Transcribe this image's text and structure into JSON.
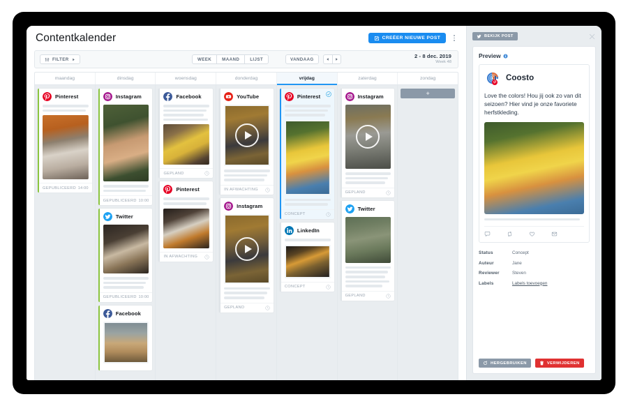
{
  "app": {
    "title": "Contentkalender",
    "create_post_label": "CREËER NIEUWE POST",
    "kebab_name": "more-options"
  },
  "toolbar": {
    "filter_label": "FILTER",
    "views": [
      {
        "label": "WEEK",
        "active": false
      },
      {
        "label": "MAAND",
        "active": false
      },
      {
        "label": "LIJST",
        "active": false
      }
    ],
    "today_label": "VANDAAG",
    "date_range": "2 - 8 dec. 2019",
    "week_label": "Week 48"
  },
  "calendar": {
    "days": [
      {
        "label": "maandag",
        "active": false
      },
      {
        "label": "dinsdag",
        "active": false
      },
      {
        "label": "woensdag",
        "active": false
      },
      {
        "label": "donderdag",
        "active": false
      },
      {
        "label": "vrijdag",
        "active": true
      },
      {
        "label": "zaterdag",
        "active": false
      },
      {
        "label": "zondag",
        "active": false
      }
    ],
    "add_label": "+",
    "status_labels": {
      "published": "GEPUBLICEERD",
      "planned": "GEPLAND",
      "pending": "IN AFWACHTING",
      "concept": "CONCEPT"
    },
    "columns": [
      {
        "day": "maandag",
        "cards": [
          {
            "network": "Pinterest",
            "status": "GEPUBLICEERD",
            "time": "14:00",
            "accent": "published",
            "lines": 2,
            "media": "car-autumn",
            "video": false,
            "framed": false,
            "thumb_h": 92,
            "selected": false
          }
        ]
      },
      {
        "day": "dinsdag",
        "cards": [
          {
            "network": "Instagram",
            "status": "GEPUBLICEERD",
            "time": "10:00",
            "accent": "published",
            "lines": 0,
            "media": "woman-coat",
            "video": false,
            "framed": false,
            "thumb_h": 110,
            "lines_after": 2,
            "selected": false
          },
          {
            "network": "Twitter",
            "status": "GEPUBLICEERD",
            "time": "10:00",
            "accent": "published",
            "lines": 0,
            "media": "table-coffee",
            "video": false,
            "framed": false,
            "thumb_h": 70,
            "lines_after": 3,
            "selected": false
          },
          {
            "network": "Facebook",
            "status": "",
            "time": "",
            "accent": "published",
            "lines": 0,
            "media": "grass-field",
            "video": false,
            "framed": true,
            "thumb_h": 60,
            "selected": false
          }
        ]
      },
      {
        "day": "woensdag",
        "cards": [
          {
            "network": "Facebook",
            "status": "GEPLAND",
            "time": "",
            "accent": "planned",
            "lines": 4,
            "media": "yellow-boots",
            "video": false,
            "framed": false,
            "thumb_h": 58,
            "selected": false
          },
          {
            "network": "Pinterest",
            "status": "IN AFWACHTING",
            "time": "",
            "accent": "pending",
            "lines": 2,
            "media": "pumpkin-book",
            "video": false,
            "framed": false,
            "thumb_h": 57,
            "selected": false
          }
        ]
      },
      {
        "day": "donderdag",
        "cards": [
          {
            "network": "YouTube",
            "status": "IN AFWACHTING",
            "time": "",
            "accent": "pending",
            "lines": 0,
            "media": "leaves-man",
            "video": true,
            "framed": true,
            "thumb_h": 88,
            "lines_after": 3,
            "selected": false
          },
          {
            "network": "Instagram",
            "status": "GEPLAND",
            "time": "",
            "accent": "planned",
            "lines": 0,
            "media": "leaves-man",
            "video": true,
            "framed": true,
            "thumb_h": 100,
            "lines_after": 3,
            "selected": false
          }
        ]
      },
      {
        "day": "vrijdag",
        "cards": [
          {
            "network": "Pinterest",
            "status": "CONCEPT",
            "time": "",
            "accent": "selected",
            "lines": 3,
            "media": "sunflower-girl",
            "video": false,
            "framed": true,
            "thumb_h": 108,
            "lines_after": 2,
            "selected": true
          },
          {
            "network": "LinkedIn",
            "status": "CONCEPT",
            "time": "",
            "accent": "concept",
            "lines": 1,
            "media": "bokeh-child",
            "video": false,
            "framed": true,
            "thumb_h": 48,
            "selected": false
          }
        ]
      },
      {
        "day": "zaterdag",
        "cards": [
          {
            "network": "Instagram",
            "status": "GEPLAND",
            "time": "",
            "accent": "planned",
            "lines": 0,
            "media": "bicycle-street",
            "video": true,
            "framed": false,
            "thumb_h": 92,
            "lines_after": 3,
            "selected": false
          },
          {
            "network": "Twitter",
            "status": "GEPLAND",
            "time": "",
            "accent": "planned",
            "lines": 0,
            "media": "green-sweater",
            "video": false,
            "framed": false,
            "thumb_h": 66,
            "lines_after": 5,
            "selected": false
          }
        ]
      },
      {
        "day": "zondag",
        "cards": []
      }
    ]
  },
  "preview": {
    "view_post_label": "BEKIJK POST",
    "close_name": "close-icon",
    "panel_title": "Preview",
    "author": "Coosto",
    "post_text": "Love the colors! Hou jij ook zo van dit seizoen? Hier vind je onze favoriete herfstkleding.",
    "actions": [
      "reply-icon",
      "retweet-icon",
      "like-icon",
      "message-icon"
    ],
    "meta": [
      {
        "key": "Status",
        "value": "Concept",
        "link": false
      },
      {
        "key": "Auteur",
        "value": "Jane",
        "link": false
      },
      {
        "key": "Reviewer",
        "value": "Steven",
        "link": false
      },
      {
        "key": "Labels",
        "value": "Labels toevoegen",
        "link": true
      }
    ],
    "reuse_label": "HERGEBRUIKEN",
    "delete_label": "VERWIJDEREN"
  },
  "colors": {
    "accent_blue": "#1a8cf0",
    "published_green": "#8bc53f",
    "selected_blue": "#2196f3",
    "delete_red": "#e03131",
    "muted": "#9aa5b1"
  }
}
